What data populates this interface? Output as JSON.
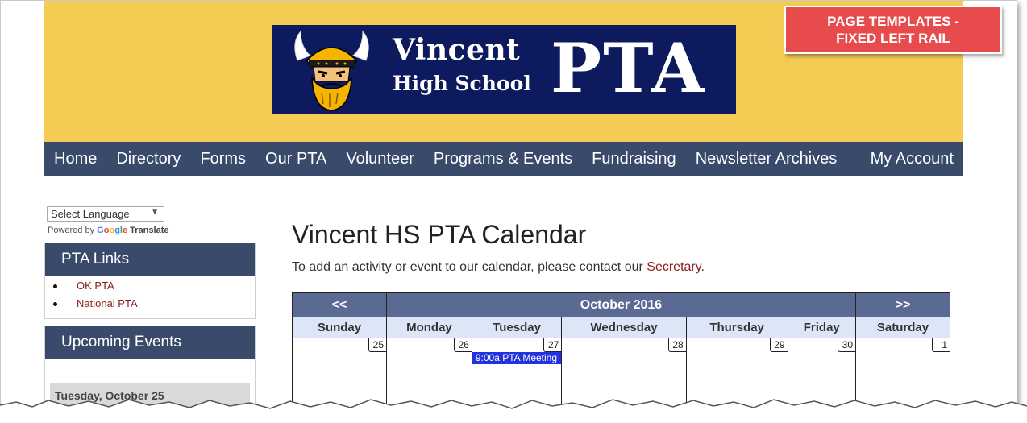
{
  "callout": {
    "line1": "PAGE TEMPLATES -",
    "line2": "FIXED LEFT RAIL"
  },
  "logo": {
    "line1": "Vincent",
    "line2": "High School",
    "pta": "PTA",
    "background": "#0d1b5e",
    "icon": "viking-mascot-icon"
  },
  "header": {
    "background": "#f4cb53"
  },
  "nav": {
    "items": [
      "Home",
      "Directory",
      "Forms",
      "Our PTA",
      "Volunteer",
      "Programs & Events",
      "Fundraising",
      "Newsletter Archives"
    ],
    "account": "My Account",
    "background": "#3a4a6b"
  },
  "translate": {
    "select_value": "Select Language",
    "powered_by": "Powered by",
    "google": "Google",
    "translate_label": "Translate"
  },
  "sidebar": {
    "links_title": "PTA Links",
    "links": [
      "OK PTA",
      "National PTA"
    ],
    "events_title": "Upcoming Events",
    "events_date": "Tuesday, October 25"
  },
  "main": {
    "title": "Vincent HS PTA Calendar",
    "desc_prefix": "To add an activity or event to our calendar, please contact our ",
    "desc_link": "Secretary",
    "desc_suffix": "."
  },
  "calendar": {
    "prev": "<<",
    "next": ">>",
    "month": "October 2016",
    "days": [
      "Sunday",
      "Monday",
      "Tuesday",
      "Wednesday",
      "Thursday",
      "Friday",
      "Saturday"
    ],
    "week": [
      "25",
      "26",
      "27",
      "28",
      "29",
      "30",
      "1"
    ],
    "event": "9:00a PTA Meeting"
  }
}
